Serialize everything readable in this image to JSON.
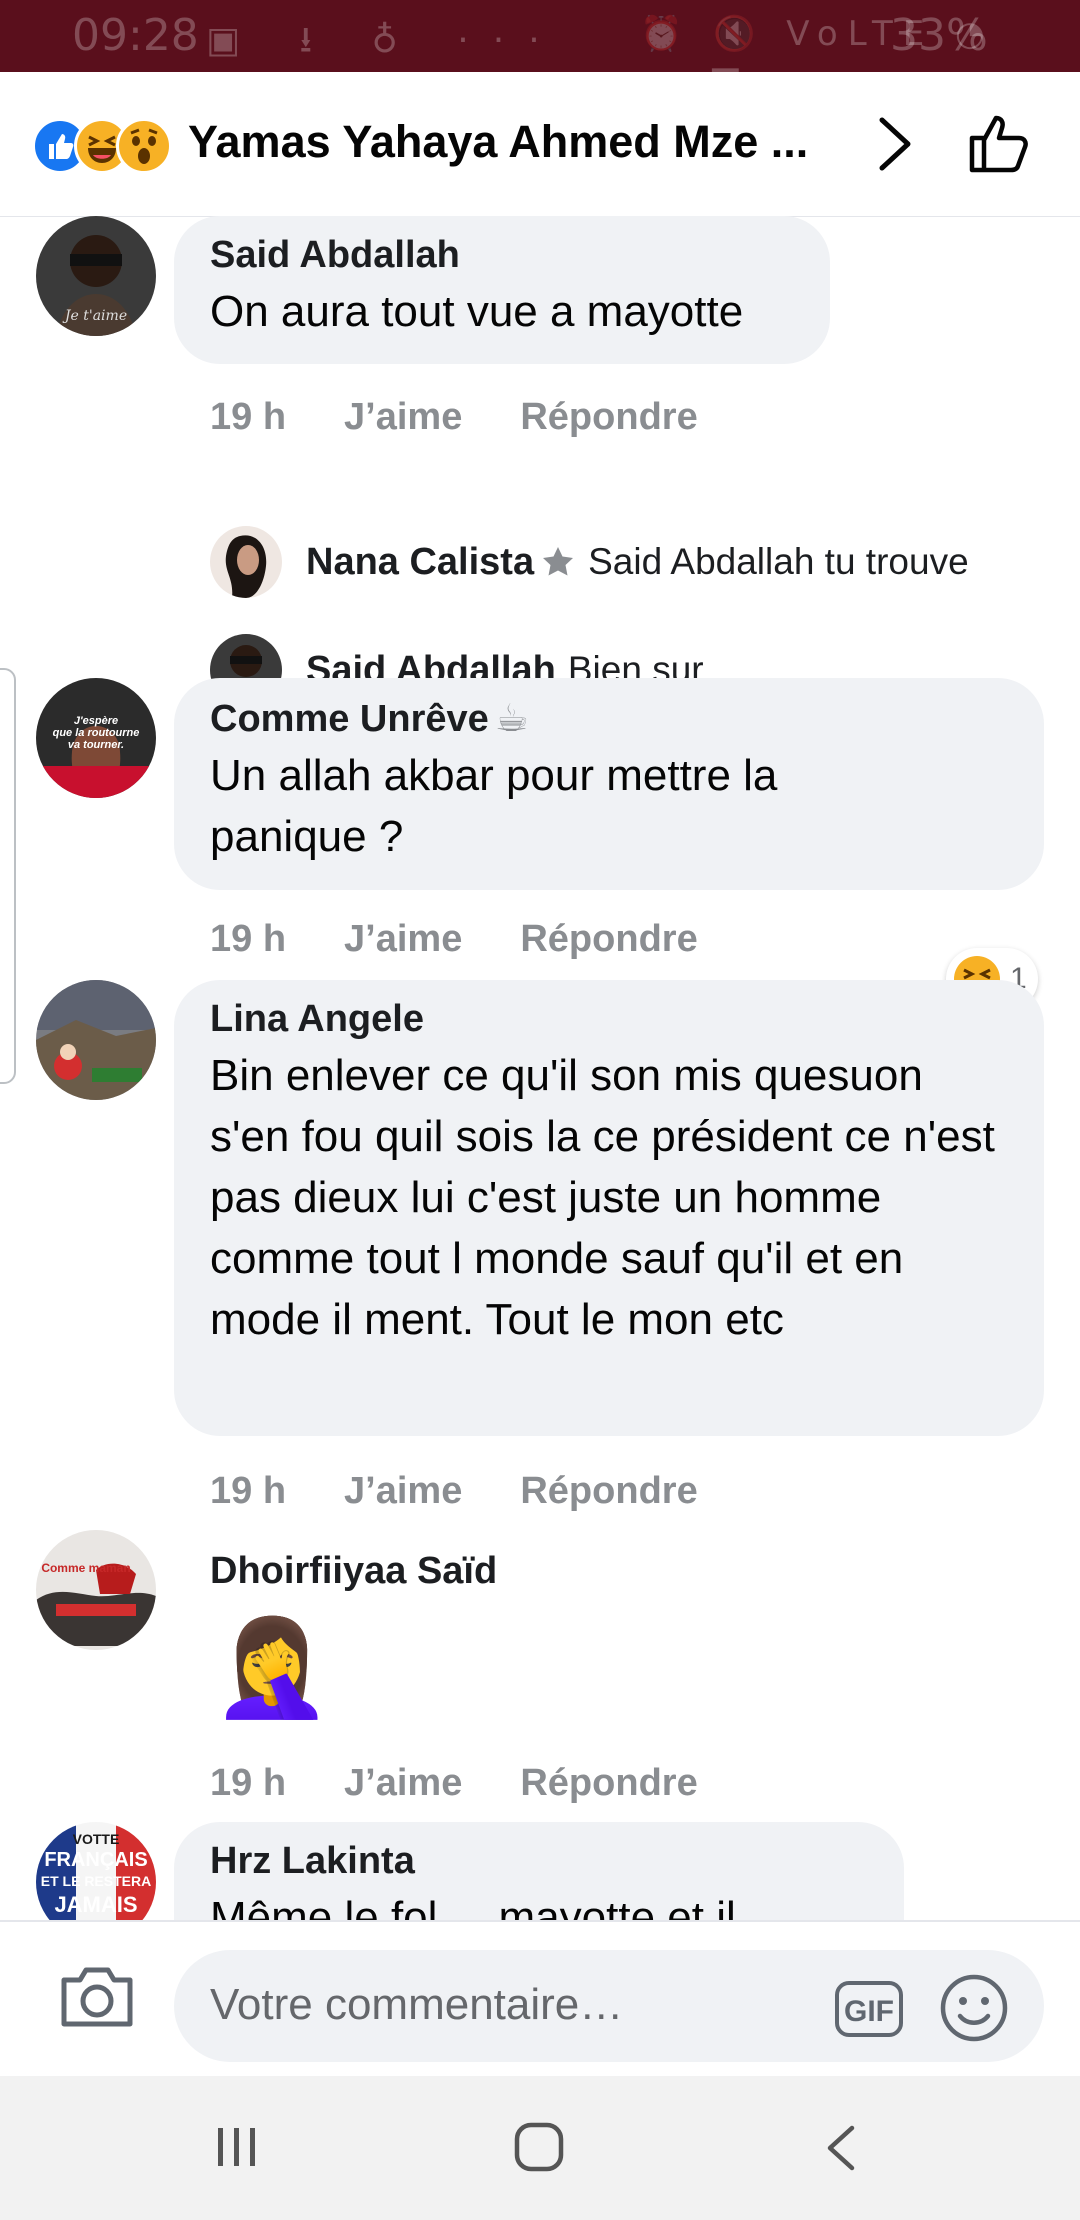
{
  "status_bar": {
    "time": "09:28",
    "left_icons": "▣ ⭳ ♁ ···",
    "right_icons": "⏰ 🔇 VoLTE ◔ ▁▃▅",
    "battery": "33%"
  },
  "header": {
    "title": "Yamas Yahaya Ahmed Mze ...",
    "reaction_icons": [
      "like-icon",
      "haha-icon",
      "wow-icon"
    ]
  },
  "comments": [
    {
      "author": "Said Abdallah",
      "text": "On aura tout vue a mayotte",
      "time": "19 h",
      "like_label": "J’aime",
      "reply_label": "Répondre",
      "replies": [
        {
          "author": "Nana Calista",
          "text": "Said Abdallah tu trouve"
        },
        {
          "author": "Said Abdallah",
          "text": "Bien sur"
        }
      ]
    },
    {
      "author": "Comme Unrêve",
      "author_emoji": "☕",
      "text": "Un allah akbar pour mettre la panique ?",
      "time": "19 h",
      "like_label": "J’aime",
      "reply_label": "Répondre",
      "reaction_count": "1"
    },
    {
      "author": "Lina Angele",
      "text": "Bin enlever ce qu'il son mis quesuon s'en fou quil sois la ce président ce n'est pas dieux lui c'est juste un homme comme tout l monde sauf qu'il et en mode il ment. Tout le mon etc",
      "time": "19 h",
      "like_label": "J’aime",
      "reply_label": "Répondre"
    },
    {
      "author": "Dhoirfiiyaa Saïd",
      "text": "🤦‍♀️",
      "time": "19 h",
      "like_label": "J’aime",
      "reply_label": "Répondre"
    },
    {
      "author": "Hrz Lakinta",
      "text": "Même le fol ... mayotte et il"
    }
  ],
  "input_bar": {
    "placeholder": "Votre commentaire…",
    "gif_label": "GIF"
  },
  "avatar_texts": {
    "comme_unreve": "J'espère que la routourne va tourner.",
    "dhoirfiiyaa": "Comme maman",
    "hrz": "VOTTE FRANÇAIS ET LE RESTERA JAMAIS"
  },
  "colors": {
    "status_bar_bg": "#5a0f1c",
    "bubble_bg": "#f0f2f5",
    "like_blue": "#1877f2",
    "meta_grey": "#8a8d91"
  }
}
